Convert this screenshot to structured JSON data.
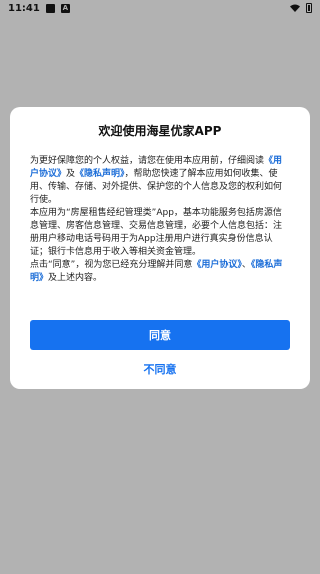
{
  "status_bar": {
    "time": "11:41",
    "notification_icon": "notification-square-icon",
    "app_icon_letter": "A"
  },
  "dialog": {
    "title": "欢迎使用海星优家APP",
    "p1_a": "为更好保障您的个人权益，请您在使用本应用前，仔细阅读",
    "user_agreement": "《用户协议》",
    "p1_and": "及",
    "privacy_policy": "《隐私声明》",
    "p1_b": "，帮助您快速了解本应用如何收集、使用、传输、存储、对外提供、保护您的个人信息及您的权利如何行使。",
    "p2": "本应用为“房屋租售经纪管理类”App，基本功能服务包括房源信息管理、房客信息管理、交易信息管理，必要个人信息包括：注册用户移动电话号码用于为App注册用户进行真实身份信息认证；银行卡信息用于收入等相关资金管理。",
    "p3_a": "点击“同意”，视为您已经充分理解并同意",
    "p3_user_agreement": "《用户协议》",
    "p3_sep": "、",
    "p3_privacy_policy": "《隐私声明》",
    "p3_b": "及上述内容。",
    "agree_label": "同意",
    "disagree_label": "不同意"
  },
  "colors": {
    "accent": "#1672f0",
    "link": "#1d6ed8",
    "overlay": "#b2b2b2"
  }
}
